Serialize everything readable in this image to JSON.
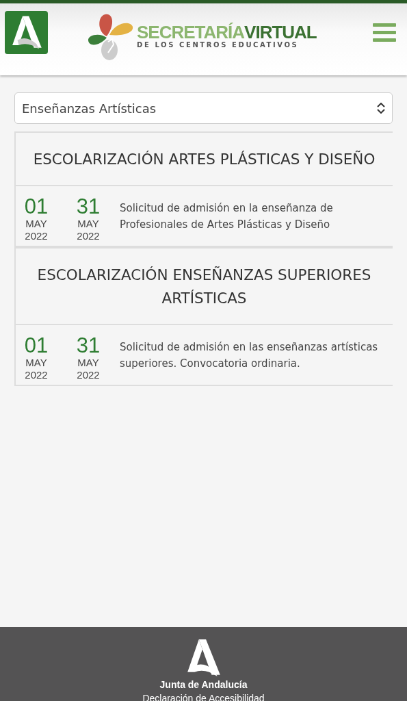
{
  "header": {
    "logo": {
      "title_light": "SECRETARÍA",
      "title_dark": "VIRTUAL",
      "subtitle": "DE LOS CENTROS EDUCATIVOS"
    }
  },
  "filter": {
    "value": "Enseñanzas Artísticas"
  },
  "sections": [
    {
      "title": "ESCOLARIZACIÓN ARTES PLÁSTICAS Y DISEÑO",
      "items": [
        {
          "start": {
            "day": "01",
            "month": "MAY",
            "year": "2022"
          },
          "end": {
            "day": "31",
            "month": "MAY",
            "year": "2022"
          },
          "description": "Solicitud de admisión en la enseñanza de Profesionales de Artes Plásticas y Diseño"
        }
      ]
    },
    {
      "title": "ESCOLARIZACIÓN ENSEÑANZAS SUPERIORES ARTÍSTICAS",
      "items": [
        {
          "start": {
            "day": "01",
            "month": "MAY",
            "year": "2022"
          },
          "end": {
            "day": "31",
            "month": "MAY",
            "year": "2022"
          },
          "description": "Solicitud de admisión en las enseñanzas artísticas superiores. Convocatoria ordinaria."
        }
      ]
    }
  ],
  "footer": {
    "name": "Junta de Andalucía",
    "link": "Declaración de Accesibilidad"
  }
}
